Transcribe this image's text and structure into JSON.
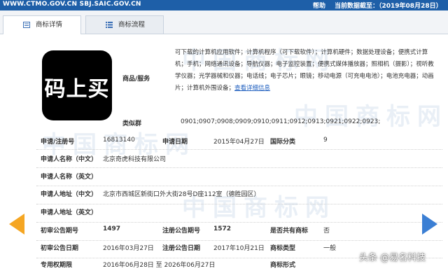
{
  "topbar": {
    "url": "WWW.CTMO.GOV.CN SBJ.SAIC.GOV.CN",
    "help": "帮助",
    "date": "当前数据截至：（2019年08月28日）"
  },
  "tabs": [
    {
      "label": "商标详情",
      "icon": "document-icon",
      "active": true
    },
    {
      "label": "商标流程",
      "icon": "list-icon",
      "active": false
    }
  ],
  "logo_text": "码上买",
  "watermark": "中国商标网",
  "goods": {
    "label": "商品/服务",
    "text": "可下载的计算机应用软件；计算机程序（可下载软件）；计算机硬件；数据处理设备；便携式计算机；手机；网络通讯设备；导航仪器；电子监控装置；便携式媒体播放器；照相机（摄影）；视听教学仪器；光学器械和仪器；电话线；电子芯片；眼镜；移动电源（可充电电池）；电池充电器；动画片；计算机外围设备；",
    "more_link": "查看详细信息"
  },
  "similar_group": {
    "label": "类似群",
    "value": "0901;0907;0908;0909;0910;0911;0912;0913;0921;0922;0923;"
  },
  "fields": {
    "reg_no_label": "申请/注册号",
    "reg_no": "16813140",
    "app_date_label": "申请日期",
    "app_date": "2015年04月27日",
    "intl_class_label": "国际分类",
    "intl_class": "9",
    "applicant_cn_label": "申请人名称（中文）",
    "applicant_cn": "北京奇虎科技有限公司",
    "applicant_en_label": "申请人名称（英文）",
    "applicant_en": "",
    "address_cn_label": "申请人地址（中文）",
    "address_cn": "北京市西城区新街口外大街28号D座112室（德胜园区）",
    "address_en_label": "申请人地址（英文）",
    "address_en": "",
    "prelim_no_label": "初审公告期号",
    "prelim_no": "1497",
    "reg_pub_no_label": "注册公告期号",
    "reg_pub_no": "1572",
    "shared_label": "是否共有商标",
    "shared": "否",
    "prelim_date_label": "初审公告日期",
    "prelim_date": "2016年03月27日",
    "reg_date_label": "注册公告日期",
    "reg_date": "2017年10月21日",
    "tm_type_label": "商标类型",
    "tm_type": "一般",
    "exclusive_label": "专用权期限",
    "exclusive": "2016年06月28日 至 2026年06月27日",
    "tm_form_label": "商标形式",
    "tm_form": ""
  },
  "credit": "头条 @易名科技"
}
